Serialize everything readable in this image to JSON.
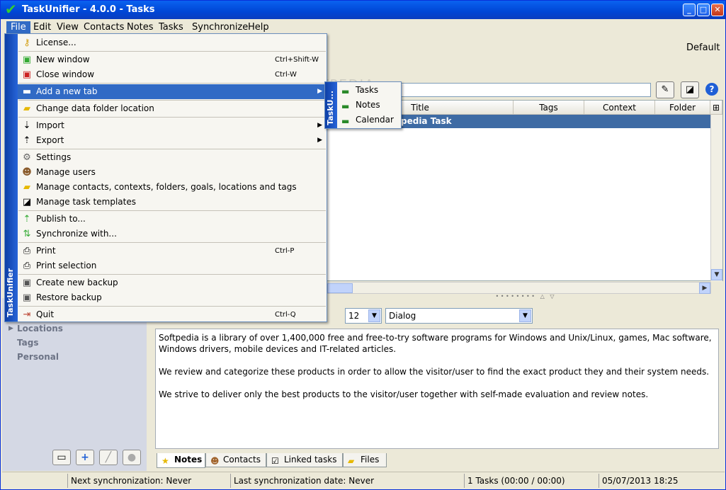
{
  "window": {
    "title": "TaskUnifier - 4.0.0 - Tasks",
    "minimize": "_",
    "maximize": "□",
    "close": "✕"
  },
  "menubar": [
    "File",
    "Edit",
    "View",
    "Contacts",
    "Notes",
    "Tasks",
    "Synchronize",
    "Help"
  ],
  "toolbar": {
    "profile": "Default",
    "help": "?"
  },
  "grid": {
    "columns": [
      "Title",
      "Tags",
      "Context",
      "Folder"
    ],
    "selected_row": "pedia Task"
  },
  "left_panel": {
    "items": [
      "Locations",
      "Tags",
      "Personal"
    ]
  },
  "editor": {
    "font_size": "12",
    "font_family": "Dialog",
    "paragraphs": [
      "Softpedia is a library of over 1,400,000 free and free-to-try software programs for Windows and Unix/Linux, games, Mac software, Windows drivers, mobile devices and IT-related articles.",
      "We review and categorize these products in order to allow the visitor/user to find the exact product they and their system needs.",
      "We strive to deliver only the best products to the visitor/user together with self-made evaluation and review notes."
    ]
  },
  "tabs": [
    "Notes",
    "Contacts",
    "Linked tasks",
    "Files"
  ],
  "status": {
    "next_sync": "Next synchronization: Never",
    "last_sync": "Last synchronization date: Never",
    "tasks": "1 Tasks (00:00 / 00:00)",
    "datetime": "05/07/2013 18:25"
  },
  "file_menu": {
    "strip_label": "TaskUnifier",
    "items": [
      {
        "label": "License...",
        "shortcut": ""
      },
      {
        "label": "New window",
        "shortcut": "Ctrl+Shift-W"
      },
      {
        "label": "Close window",
        "shortcut": "Ctrl-W"
      },
      {
        "label": "Add a new tab",
        "shortcut": ""
      },
      {
        "label": "Change data folder location",
        "shortcut": ""
      },
      {
        "label": "Import",
        "shortcut": ""
      },
      {
        "label": "Export",
        "shortcut": ""
      },
      {
        "label": "Settings",
        "shortcut": ""
      },
      {
        "label": "Manage users",
        "shortcut": ""
      },
      {
        "label": "Manage contacts, contexts, folders, goals, locations and tags",
        "shortcut": ""
      },
      {
        "label": "Manage task templates",
        "shortcut": ""
      },
      {
        "label": "Publish to...",
        "shortcut": ""
      },
      {
        "label": "Synchronize with...",
        "shortcut": ""
      },
      {
        "label": "Print",
        "shortcut": "Ctrl-P"
      },
      {
        "label": "Print selection",
        "shortcut": ""
      },
      {
        "label": "Create new backup",
        "shortcut": ""
      },
      {
        "label": "Restore backup",
        "shortcut": ""
      },
      {
        "label": "Quit",
        "shortcut": "Ctrl-Q"
      }
    ]
  },
  "submenu": {
    "strip_label": "TaskU...",
    "items": [
      "Tasks",
      "Notes",
      "Calendar"
    ]
  },
  "watermark": "SOFTPEDIA"
}
